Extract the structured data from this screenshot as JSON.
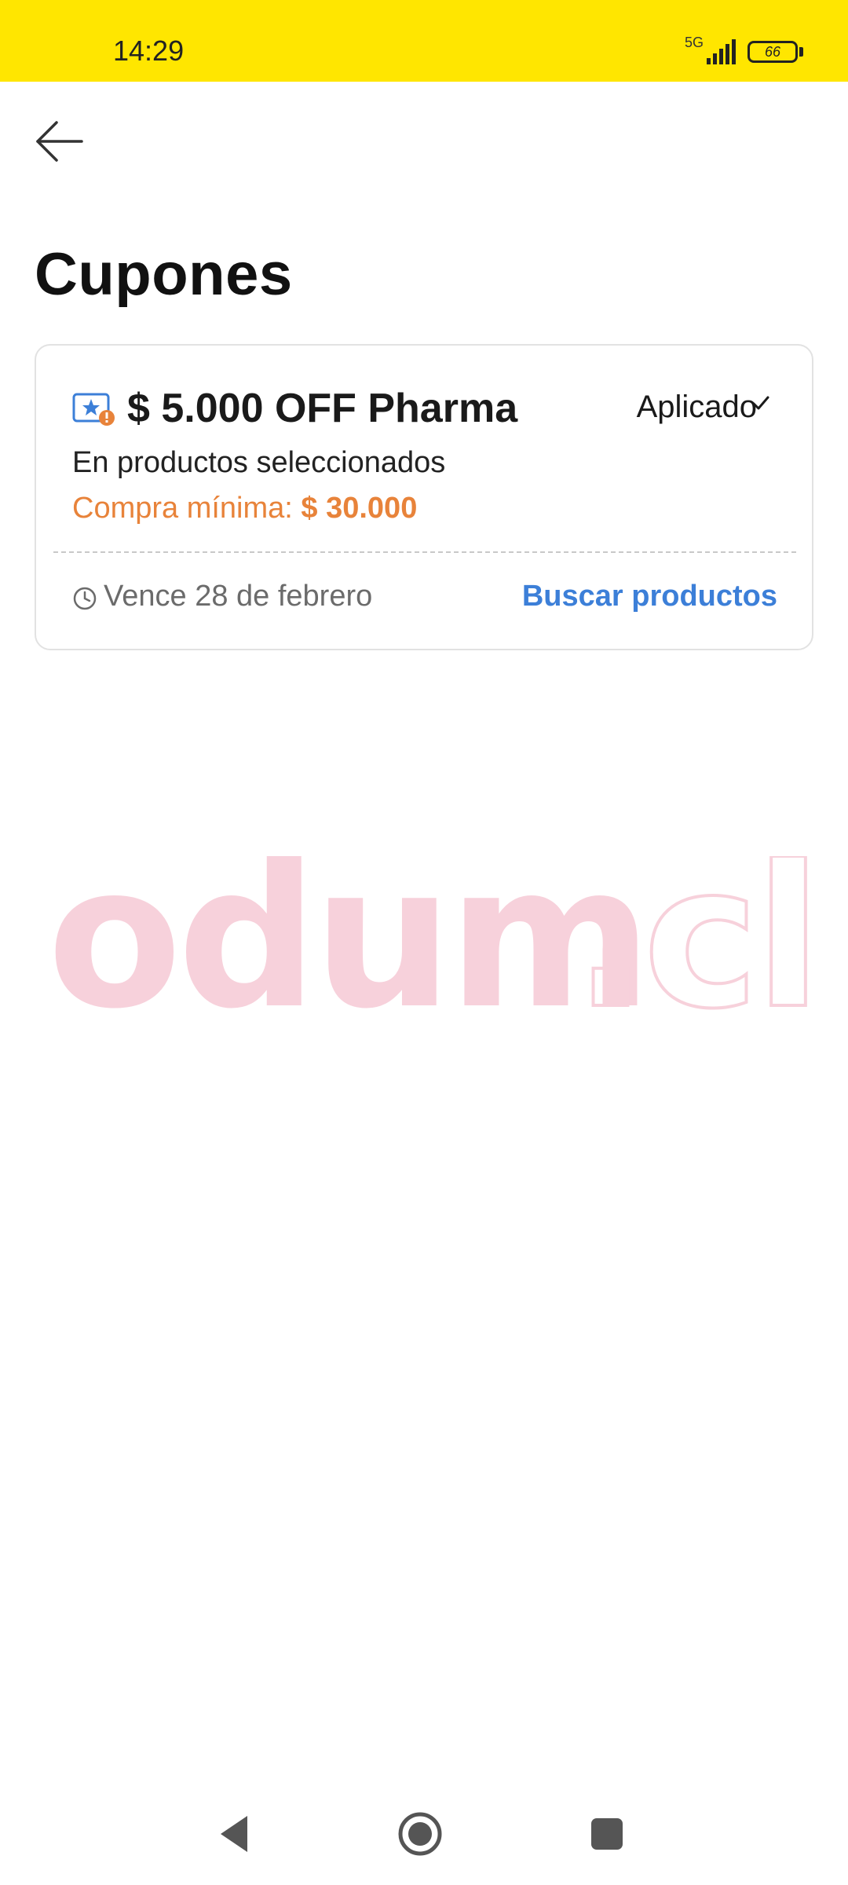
{
  "status_bar": {
    "time": "14:29",
    "network": "5G",
    "battery": "66",
    "background": "#ffe600"
  },
  "header": {
    "back_icon": "arrow-left-icon",
    "title": "Cupones"
  },
  "coupon": {
    "icon": "coupon-star-icon",
    "title": "$ 5.000 OFF Pharma",
    "status": "Aplicado",
    "status_icon": "check-icon",
    "subtitle": "En productos seleccionados",
    "min_purchase_label": "Compra mínima:",
    "min_purchase_amount": "$ 30.000",
    "expiry_icon": "clock-icon",
    "expiry": "Vence 28 de febrero",
    "action": "Buscar productos",
    "accent_color": "#e8833a",
    "link_color": "#3c7fd8"
  },
  "watermark": {
    "text": "odum.cl"
  },
  "nav": {
    "back": "triangle-back-icon",
    "home": "circle-home-icon",
    "recents": "square-recents-icon"
  }
}
